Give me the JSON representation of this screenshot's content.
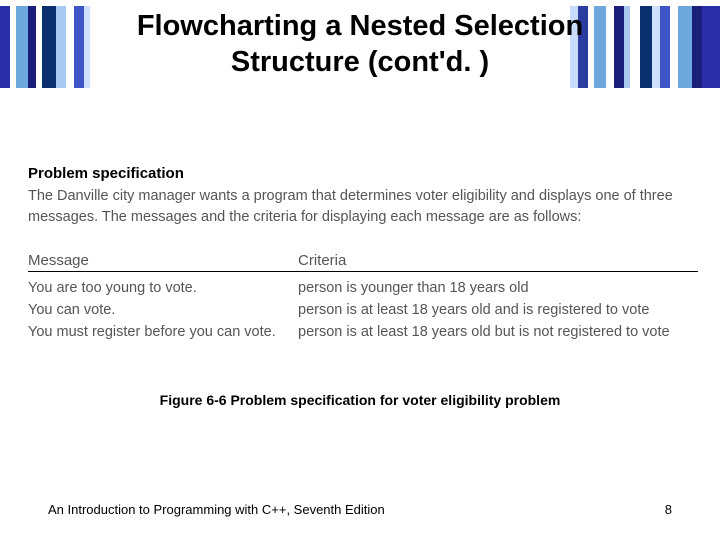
{
  "title_line1": "Flowcharting a Nested Selection",
  "title_line2": "Structure (cont'd. )",
  "spec": {
    "heading": "Problem specification",
    "body": "The Danville city manager wants a program that determines voter eligibility and displays one of three messages. The messages and the criteria for displaying each message are as follows:"
  },
  "table": {
    "head_message": "Message",
    "head_criteria": "Criteria",
    "rows": [
      {
        "message": "You are too young to vote.",
        "criteria": "person is younger than 18 years old"
      },
      {
        "message": "You can vote.",
        "criteria": "person is at least 18 years old and is registered to vote"
      },
      {
        "message": "You must register before you can vote.",
        "criteria": "person is at least 18 years old but is not registered to vote"
      }
    ]
  },
  "figure_caption": "Figure 6-6 Problem specification for voter eligibility problem",
  "footer_left": "An Introduction to Programming with C++, Seventh Edition",
  "footer_right": "8"
}
